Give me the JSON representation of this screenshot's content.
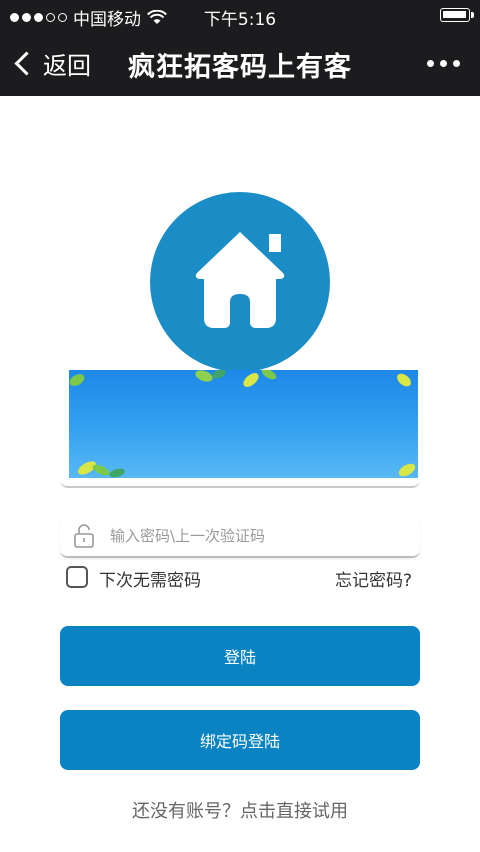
{
  "status_bar": {
    "carrier": "中国移动",
    "time": "下午5:16",
    "battery_level": 1.0
  },
  "nav": {
    "back_label": "返回",
    "title": "疯狂拓客码上有客"
  },
  "login": {
    "password_placeholder": "输入密码\\上一次验证码",
    "remember_label": "下次无需密码",
    "forgot_label": "忘记密码?",
    "login_button": "登陆",
    "bind_button": "绑定码登陆",
    "trial_link": "还没有账号？点击直接试用"
  },
  "colors": {
    "bar_bg": "#1c1c1e",
    "primary": "#0a83c3",
    "logo": "#1a8cc6"
  },
  "icons": [
    "back-chevron-icon",
    "more-icon",
    "home-icon",
    "lock-icon",
    "wifi-icon",
    "leaf-icon"
  ]
}
